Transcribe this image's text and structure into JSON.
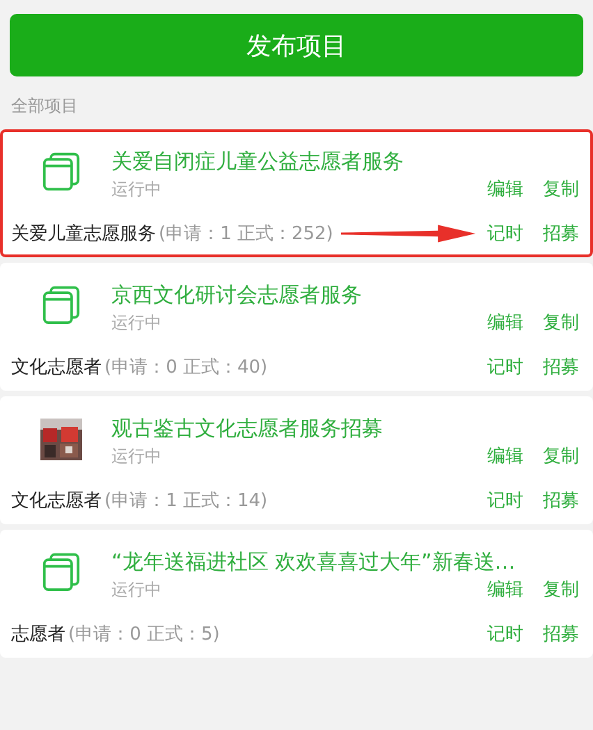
{
  "publish_button": "发布项目",
  "section_label": "全部项目",
  "projects": [
    {
      "icon": {
        "kind": "folder"
      },
      "title": "关爱自闭症儿童公益志愿者服务",
      "status": "运行中",
      "actions_top": [
        "编辑",
        "复制"
      ],
      "group": "关爱儿童志愿服务",
      "counts": "(申请：1 正式：252)",
      "actions_bottom": [
        "记时",
        "招募"
      ],
      "highlighted": true
    },
    {
      "icon": {
        "kind": "folder"
      },
      "title": "京西文化研讨会志愿者服务",
      "status": "运行中",
      "actions_top": [
        "编辑",
        "复制"
      ],
      "group": "文化志愿者",
      "counts": "(申请：0 正式：40)",
      "actions_bottom": [
        "记时",
        "招募"
      ],
      "highlighted": false
    },
    {
      "title": "观古鉴古文化志愿者服务招募",
      "status": "运行中",
      "actions_top": [
        "编辑",
        "复制"
      ],
      "group": "文化志愿者",
      "counts": "(申请：1 正式：14)",
      "actions_bottom": [
        "记时",
        "招募"
      ],
      "highlighted": false
    },
    {
      "icon": {
        "kind": "folder"
      },
      "title": "“龙年送福进社区 欢欢喜喜过大年”新春送…",
      "status": "运行中",
      "actions_top": [
        "编辑",
        "复制"
      ],
      "group": "志愿者",
      "counts": "(申请：0 正式：5)",
      "actions_bottom": [
        "记时",
        "招募"
      ],
      "highlighted": false
    }
  ]
}
